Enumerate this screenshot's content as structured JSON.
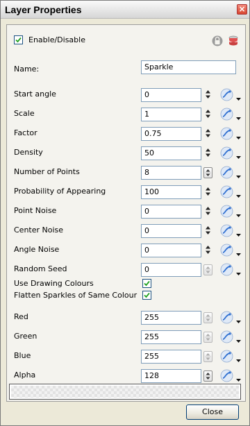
{
  "window": {
    "title": "Layer Properties",
    "close_glyph": "×"
  },
  "enable": {
    "label": "Enable/Disable",
    "checked": true
  },
  "header_icons": [
    "lock-icon",
    "database-icon"
  ],
  "name": {
    "label": "Name:",
    "value": "Sparkle"
  },
  "params": [
    {
      "label": "Start angle",
      "value": "0",
      "spinner": "arrows"
    },
    {
      "label": "Scale",
      "value": "1",
      "spinner": "arrows"
    },
    {
      "label": "Factor",
      "value": "0.75",
      "spinner": "arrows"
    },
    {
      "label": "Density",
      "value": "50",
      "spinner": "arrows"
    },
    {
      "label": "Number of Points",
      "value": "8",
      "spinner": "box"
    },
    {
      "label": "Probability of Appearing",
      "value": "100",
      "spinner": "arrows"
    },
    {
      "label": "Point Noise",
      "value": "0",
      "spinner": "arrows"
    },
    {
      "label": "Center Noise",
      "value": "0",
      "spinner": "arrows"
    },
    {
      "label": "Angle Noise",
      "value": "0",
      "spinner": "arrows"
    },
    {
      "label": "Random Seed",
      "value": "0",
      "spinner": "box-dim"
    }
  ],
  "checks": [
    {
      "label": "Use Drawing Colours",
      "checked": true
    },
    {
      "label": "Flatten Sparkles of Same Colour",
      "checked": true
    }
  ],
  "colors": [
    {
      "label": "Red",
      "value": "255",
      "spinner": "box-dim"
    },
    {
      "label": "Green",
      "value": "255",
      "spinner": "box-dim"
    },
    {
      "label": "Blue",
      "value": "255",
      "spinner": "box-dim"
    },
    {
      "label": "Alpha",
      "value": "128",
      "spinner": "box"
    }
  ],
  "close_button": {
    "label": "Close"
  },
  "colors_hex": {
    "checkmark": "#21a121",
    "function_icon": "#2f6fd0",
    "lock": "#6e6e6e",
    "db": "#e05050"
  }
}
